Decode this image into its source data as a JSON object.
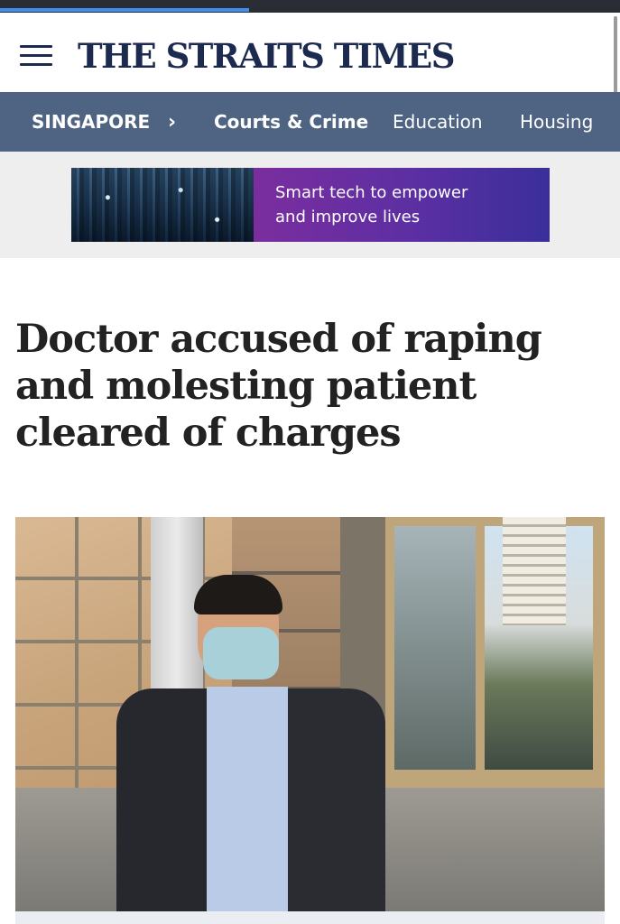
{
  "masthead": {
    "logo_text": "THE STRAITS TIMES",
    "menu_icon": "hamburger-menu-icon"
  },
  "nav": {
    "section": "SINGAPORE",
    "chevron": "›",
    "items": [
      {
        "label": "Courts & Crime",
        "active": true
      },
      {
        "label": "Education",
        "active": false
      },
      {
        "label": "Housing",
        "active": false
      }
    ]
  },
  "ad": {
    "line1": "Smart tech to empower",
    "line2": "and improve lives"
  },
  "article": {
    "headline": "Doctor accused of raping and molesting patient cleared of charges"
  },
  "colors": {
    "brand_navy": "#1b2a4e",
    "nav_bg": "#4f6483",
    "progress": "#3f8ff0",
    "ad_purple": "#6b2fa0"
  }
}
